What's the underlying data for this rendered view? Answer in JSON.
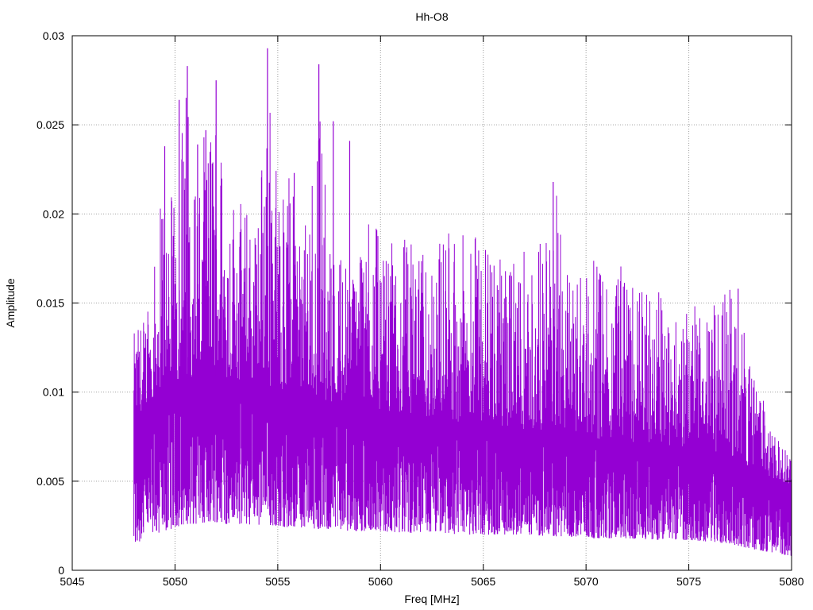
{
  "chart_data": {
    "type": "line",
    "title": "Hh-O8",
    "xlabel": "Freq [MHz]",
    "ylabel": "Amplitude",
    "xlim": [
      5045,
      5080
    ],
    "ylim": [
      0,
      0.03
    ],
    "xticks": [
      5045,
      5050,
      5055,
      5060,
      5065,
      5070,
      5075,
      5080
    ],
    "yticks": [
      0,
      0.005,
      0.01,
      0.015,
      0.02,
      0.025,
      0.03
    ],
    "xtick_labels": [
      "5045",
      "5050",
      "5055",
      "5060",
      "5065",
      "5070",
      "5075",
      "5080"
    ],
    "ytick_labels": [
      "0",
      "0.005",
      "0.01",
      "0.015",
      "0.02",
      "0.025",
      "0.03"
    ],
    "grid": true,
    "series": [
      {
        "color": "#9400d3",
        "envelope": {
          "x": [
            5048.0,
            5048.5,
            5049.0,
            5049.5,
            5050.0,
            5050.5,
            5051.0,
            5051.5,
            5052.0,
            5052.5,
            5053.0,
            5053.5,
            5054.0,
            5054.5,
            5055.0,
            5055.5,
            5056.0,
            5056.5,
            5057.0,
            5057.5,
            5058.0,
            5058.5,
            5059.0,
            5059.5,
            5060.0,
            5061.0,
            5062.0,
            5063.0,
            5064.0,
            5065.0,
            5066.0,
            5067.0,
            5068.0,
            5068.5,
            5069.0,
            5070.0,
            5071.0,
            5072.0,
            5073.0,
            5074.0,
            5075.0,
            5076.0,
            5077.0,
            5078.0,
            5079.0,
            5080.0
          ],
          "upper": [
            0.0133,
            0.0145,
            0.0172,
            0.0238,
            0.0201,
            0.0283,
            0.0232,
            0.0247,
            0.0275,
            0.0218,
            0.0217,
            0.0205,
            0.0199,
            0.0293,
            0.0221,
            0.0223,
            0.0202,
            0.0198,
            0.0284,
            0.0187,
            0.0181,
            0.0183,
            0.0176,
            0.0241,
            0.0172,
            0.0193,
            0.0177,
            0.0192,
            0.0188,
            0.0195,
            0.0173,
            0.0188,
            0.0183,
            0.0218,
            0.0171,
            0.0176,
            0.0172,
            0.017,
            0.0166,
            0.0153,
            0.015,
            0.0146,
            0.0158,
            0.0124,
            0.008,
            0.0062
          ],
          "mid": [
            0.008,
            0.009,
            0.0098,
            0.0103,
            0.0106,
            0.0108,
            0.0109,
            0.011,
            0.0109,
            0.0108,
            0.0107,
            0.0106,
            0.0104,
            0.0103,
            0.0102,
            0.0101,
            0.0099,
            0.0098,
            0.0096,
            0.0095,
            0.0094,
            0.0093,
            0.0092,
            0.0091,
            0.009,
            0.0088,
            0.0086,
            0.0085,
            0.0083,
            0.0082,
            0.008,
            0.0079,
            0.0078,
            0.0077,
            0.0076,
            0.0075,
            0.0073,
            0.0072,
            0.0071,
            0.007,
            0.0069,
            0.0067,
            0.0064,
            0.0058,
            0.0052,
            0.0048
          ],
          "lower": [
            0.0012,
            0.0018,
            0.002,
            0.0022,
            0.0024,
            0.0026,
            0.0026,
            0.0027,
            0.0027,
            0.0026,
            0.0026,
            0.0026,
            0.0025,
            0.0025,
            0.0025,
            0.0024,
            0.0024,
            0.0024,
            0.0023,
            0.0023,
            0.0023,
            0.0022,
            0.0022,
            0.0022,
            0.0022,
            0.0021,
            0.0021,
            0.0021,
            0.002,
            0.002,
            0.002,
            0.002,
            0.0019,
            0.0019,
            0.0019,
            0.0018,
            0.0018,
            0.0018,
            0.0017,
            0.0017,
            0.0017,
            0.0016,
            0.0015,
            0.0012,
            0.001,
            0.0008
          ]
        },
        "peaks": [
          {
            "x": 5049.5,
            "y": 0.0238
          },
          {
            "x": 5050.2,
            "y": 0.0264
          },
          {
            "x": 5050.6,
            "y": 0.0283
          },
          {
            "x": 5051.1,
            "y": 0.0239
          },
          {
            "x": 5051.5,
            "y": 0.0247
          },
          {
            "x": 5052.0,
            "y": 0.0275
          },
          {
            "x": 5054.5,
            "y": 0.0293
          },
          {
            "x": 5055.8,
            "y": 0.0223
          },
          {
            "x": 5057.0,
            "y": 0.0284
          },
          {
            "x": 5057.7,
            "y": 0.0252
          },
          {
            "x": 5058.5,
            "y": 0.0241
          },
          {
            "x": 5068.4,
            "y": 0.0218
          },
          {
            "x": 5077.4,
            "y": 0.0158
          }
        ],
        "freq_start": 5048.0,
        "freq_end": 5080.0
      }
    ]
  }
}
